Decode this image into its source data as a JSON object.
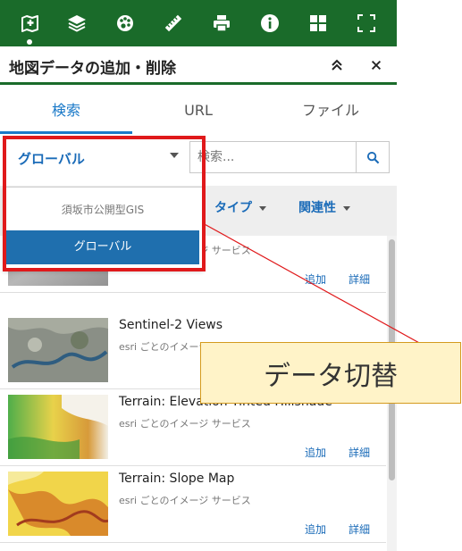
{
  "toolbar": {
    "tools": [
      {
        "icon": "add-data-icon",
        "active": true
      },
      {
        "icon": "layers-icon"
      },
      {
        "icon": "basemap-gallery-icon"
      },
      {
        "icon": "measure-ruler-icon"
      },
      {
        "icon": "print-icon"
      },
      {
        "icon": "info-icon"
      },
      {
        "icon": "grid-icon"
      },
      {
        "icon": "fullscreen-icon"
      }
    ],
    "color": "#1a6b2a"
  },
  "panel": {
    "title": "地図データの追加・削除",
    "collapse_icon": "chevron-up-double-icon",
    "close_icon": "close-icon"
  },
  "tabs": [
    {
      "label": "検索",
      "active": true
    },
    {
      "label": "URL"
    },
    {
      "label": "ファイル"
    }
  ],
  "search": {
    "scope_selected": "グローバル",
    "placeholder": "検索...",
    "button_icon": "search-icon"
  },
  "dropdown": {
    "options": [
      {
        "label": "須坂市公開型GIS"
      },
      {
        "label": "グローバル",
        "selected": true
      }
    ]
  },
  "filters": [
    {
      "label": "タイプ"
    },
    {
      "label": "関連性"
    }
  ],
  "results": [
    {
      "title": "",
      "desc": "esri ごとのイメージ サービス",
      "add": "追加",
      "details": "詳細"
    },
    {
      "title": "Sentinel-2 Views",
      "desc": "esri ごとのイメージ サービス",
      "add": "追加",
      "details": "詳細"
    },
    {
      "title": "Terrain: Elevation Tinted Hillshade",
      "desc": "esri ごとのイメージ サービス",
      "add": "追加",
      "details": "詳細"
    },
    {
      "title": "Terrain: Slope Map",
      "desc": "esri ごとのイメージ サービス",
      "add": "追加",
      "details": "詳細"
    }
  ],
  "annotation": {
    "callout_text": "データ切替",
    "highlight_color": "#e0191b",
    "callout_bg": "#fff3c8"
  }
}
